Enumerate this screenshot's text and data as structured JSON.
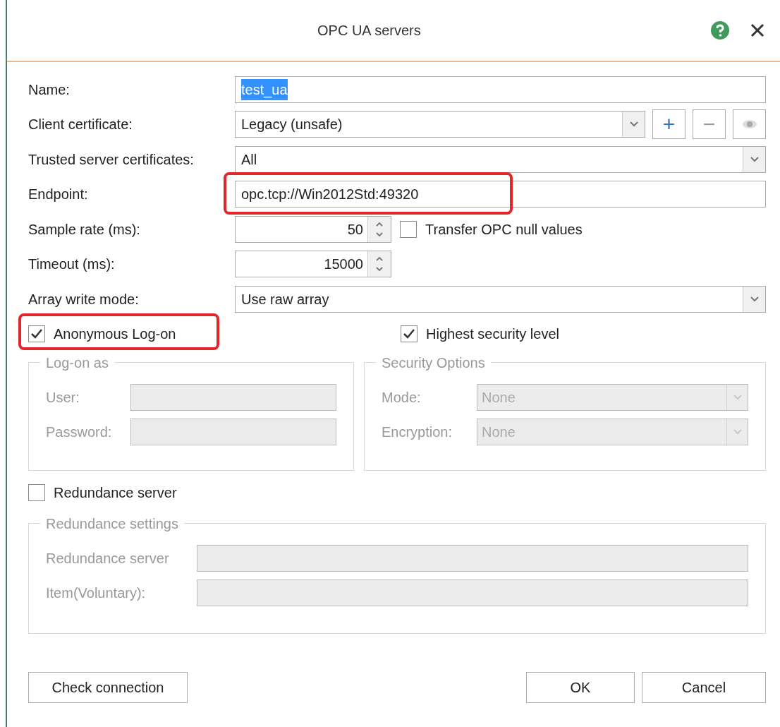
{
  "dialog": {
    "title": "OPC UA servers"
  },
  "fields": [
    {
      "kind": "text",
      "label": "Name:",
      "value": "test_ua",
      "text_selected": true,
      "highlighted": false
    },
    {
      "kind": "combo",
      "label": "Client certificate:",
      "value": "Legacy (unsafe)",
      "buttons": [
        "+",
        "−"
      ],
      "highlighted": false
    },
    {
      "kind": "combo",
      "label": "Trusted server certificates:",
      "value": "All",
      "highlighted": false
    },
    {
      "kind": "text",
      "label": "Endpoint:",
      "value": "opc.tcp://Win2012Std:49320",
      "text_selected": false,
      "highlighted": true
    },
    {
      "kind": "spin",
      "label": "Sample rate (ms):",
      "value": "50",
      "checkbox": {
        "label": "Transfer OPC null values",
        "checked": false
      },
      "highlighted": false
    },
    {
      "kind": "spin",
      "label": "Timeout (ms):",
      "value": "15000",
      "highlighted": false
    },
    {
      "kind": "combo",
      "label": "Array write mode:",
      "value": "Use raw array",
      "highlighted": false
    }
  ],
  "options": [
    {
      "label": "Anonymous Log-on",
      "checked": true,
      "highlighted": true
    },
    {
      "label": "Highest security level",
      "checked": true,
      "highlighted": false
    }
  ],
  "logon": {
    "title": "Log-on as",
    "disabled": true,
    "fields": [
      {
        "label": "User:"
      },
      {
        "label": "Password:"
      }
    ]
  },
  "security": {
    "title": "Security Options",
    "disabled": true,
    "fields": [
      {
        "label": "Mode:",
        "value": "None"
      },
      {
        "label": "Encryption:",
        "value": "None"
      }
    ]
  },
  "redundance": {
    "label": "Redundance server",
    "checked": false
  },
  "redundance_settings": {
    "title": "Redundance settings",
    "disabled": true,
    "fields": [
      {
        "label": "Redundance server"
      },
      {
        "label": "Item(Voluntary):"
      }
    ]
  },
  "buttons": [
    {
      "label": "Check connection"
    },
    {
      "label": "OK"
    },
    {
      "label": "Cancel"
    }
  ]
}
